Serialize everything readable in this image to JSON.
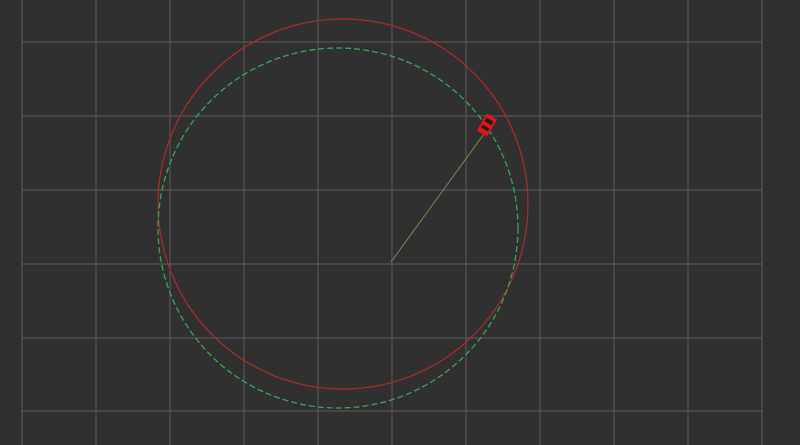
{
  "scene": {
    "background_color": "#303030",
    "grid_color": "#5c5c5c",
    "reference_path": {
      "shape": "circle",
      "color": "#b02a2a",
      "style": "solid"
    },
    "planned_path": {
      "shape": "circle",
      "color": "#3aa55a",
      "style": "dashed"
    },
    "trace_line": {
      "color": "#8a8a55",
      "style": "solid"
    },
    "vehicle": {
      "icon": "car-icon",
      "body_color": "#e01515",
      "window_color": "#1a1a1a"
    }
  }
}
